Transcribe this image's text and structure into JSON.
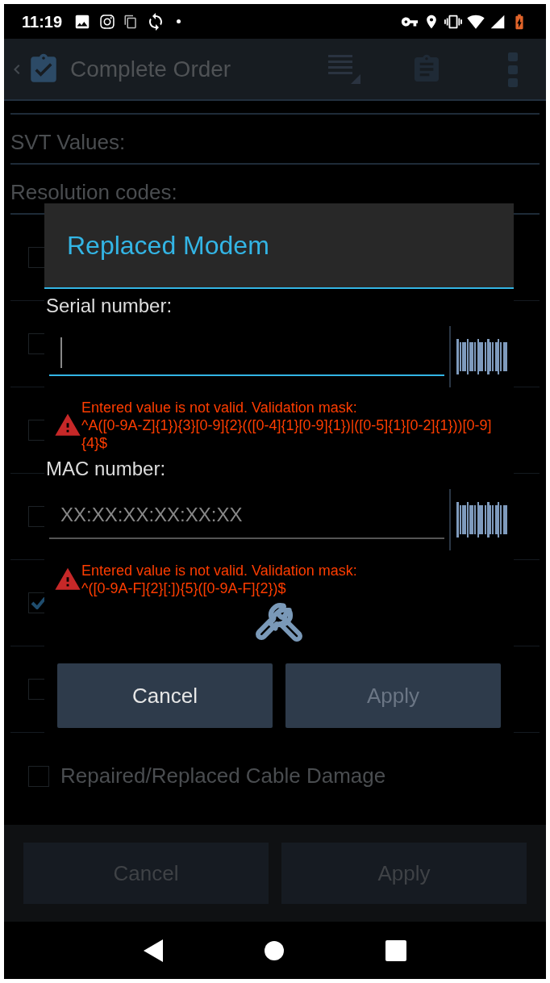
{
  "status_bar": {
    "time": "11:19"
  },
  "app_bar": {
    "title": "Complete Order"
  },
  "form": {
    "sections": [
      {
        "label": "SVT Values:"
      },
      {
        "label": "Resolution codes:"
      }
    ],
    "resolution_codes": [
      {
        "checked": false
      },
      {
        "checked": false
      },
      {
        "checked": false
      },
      {
        "checked": false
      },
      {
        "checked": true
      },
      {
        "checked": false
      },
      {
        "checked": false,
        "label": "Repaired/Replaced Cable Damage"
      }
    ],
    "buttons": [
      {
        "label": "Cancel"
      },
      {
        "label": "Apply"
      }
    ]
  },
  "dialog": {
    "title": "Replaced Modem",
    "fields": [
      {
        "label": "Serial number:",
        "focused": true,
        "error": "Entered value is not valid. Validation mask:",
        "mask": "^A([0-9A-Z]{1}){3}[0-9]{2}(([0-4]{1}[0-9]{1})|([0-5]{1}[0-2]{1}))[0-9]{4}$"
      },
      {
        "label": "MAC number:",
        "focused": false,
        "placeholder": "XX:XX:XX:XX:XX:XX",
        "error": "Entered value is not valid. Validation mask:",
        "mask": "^([0-9A-F]{2}[:]){5}([0-9A-F]{2})$"
      }
    ],
    "buttons": [
      {
        "label": "Cancel",
        "disabled": false
      },
      {
        "label": "Apply",
        "disabled": true
      }
    ]
  }
}
